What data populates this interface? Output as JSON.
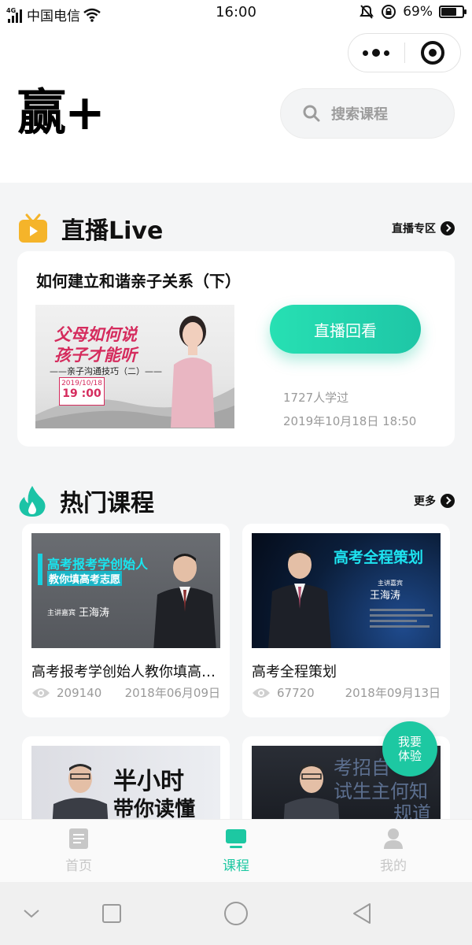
{
  "status_bar": {
    "network": "4G",
    "carrier": "中国电信",
    "time": "16:00",
    "battery": "69%"
  },
  "header": {
    "logo": "赢+",
    "search_placeholder": "搜索课程"
  },
  "live_section": {
    "title": "直播Live",
    "more_label": "直播专区",
    "card": {
      "title": "如何建立和谐亲子关系（下）",
      "thumb": {
        "headline1": "父母如何说",
        "headline2": "孩子才能听",
        "subtitle": "——亲子沟通技巧（二）——",
        "date": "2019/10/18",
        "time": "19 :00"
      },
      "button_label": "直播回看",
      "learners": "1727人学过",
      "datetime": "2019年10月18日 18:50"
    }
  },
  "hot_section": {
    "title": "热门课程",
    "more_label": "更多",
    "courses": [
      {
        "title": "高考报考学创始人教你填高考志愿",
        "views": "209140",
        "date": "2018年06月09日",
        "cover_line1": "高考报考学创始人",
        "cover_line2": "教你填高考志愿",
        "cover_speaker_label": "主讲嘉宾",
        "cover_speaker": "王海涛"
      },
      {
        "title": "高考全程策划",
        "views": "67720",
        "date": "2018年09月13日",
        "cover_line1": "高考全程策划",
        "cover_speaker_label": "主讲嘉宾",
        "cover_speaker": "王海涛"
      },
      {
        "cover_line1": "半小时",
        "cover_line2": "带你读懂"
      },
      {
        "cover_line1": "考招自",
        "cover_line2": "试生主何知",
        "cover_line3": "规道"
      }
    ]
  },
  "fab": {
    "line1": "我要",
    "line2": "体验"
  },
  "tabbar": {
    "items": [
      {
        "label": "首页",
        "icon": "document-icon"
      },
      {
        "label": "课程",
        "icon": "monitor-icon"
      },
      {
        "label": "我的",
        "icon": "person-icon"
      }
    ],
    "active_index": 1
  },
  "colors": {
    "accent": "#1dc8a2",
    "live_icon": "#f5b42a",
    "hot_icon": "#1bc3a6",
    "muted": "#9a9a9a"
  }
}
